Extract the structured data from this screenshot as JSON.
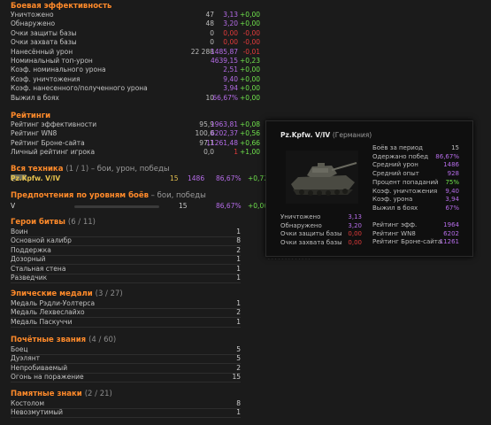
{
  "combat": {
    "title": "Боевая эффективность",
    "rows": [
      {
        "label": "Уничтожено",
        "v1": "47",
        "v2": "3,13",
        "v3": "+0,00",
        "c2": "pur",
        "c3": "grn"
      },
      {
        "label": "Обнаружено",
        "v1": "48",
        "v2": "3,20",
        "v3": "+0,00",
        "c2": "pur",
        "c3": "grn"
      },
      {
        "label": "Очки защиты базы",
        "v1": "0",
        "v2": "0,00",
        "v3": "-0,00",
        "c2": "red",
        "c3": "red"
      },
      {
        "label": "Очки захвата базы",
        "v1": "0",
        "v2": "0,00",
        "v3": "-0,00",
        "c2": "red",
        "c3": "red"
      },
      {
        "label": "Нанесённый урон",
        "v1": "22 288",
        "v2": "1485,87",
        "v3": "-0,01",
        "c2": "pur",
        "c3": "red"
      },
      {
        "label": "Номинальный топ-урон",
        "v1": "",
        "v2": "4639,15",
        "v3": "+0,23",
        "c2": "pur",
        "c3": "grn"
      },
      {
        "label": "Коэф. номинального урона",
        "v1": "",
        "v2": "2,51",
        "v3": "+0,00",
        "c2": "pur",
        "c3": "grn"
      },
      {
        "label": "Коэф. уничтожения",
        "v1": "",
        "v2": "9,40",
        "v3": "+0,00",
        "c2": "pur",
        "c3": "grn"
      },
      {
        "label": "Коэф. нанесенного/полученного урона",
        "v1": "",
        "v2": "3,94",
        "v3": "+0,00",
        "c2": "pur",
        "c3": "grn"
      },
      {
        "label": "Выжил в боях",
        "v1": "10",
        "v2": "66,67%",
        "v3": "+0,00",
        "c2": "pur",
        "c3": "grn"
      }
    ]
  },
  "ratings": {
    "title": "Рейтинги",
    "rows": [
      {
        "label": "Рейтинг эффективности",
        "v1": "95,9",
        "v2": "1963,81",
        "v3": "+0,08",
        "c2": "pur",
        "c3": "grn"
      },
      {
        "label": "Рейтинг WN8",
        "v1": "100,0",
        "v2": "6202,37",
        "v3": "+0,56",
        "c2": "pur",
        "c3": "grn"
      },
      {
        "label": "Рейтинг Броне-сайта",
        "v1": "97,1",
        "v2": "11261,48",
        "v3": "+0,66",
        "c2": "pur",
        "c3": "grn"
      },
      {
        "label": "Личный рейтинг игрока",
        "v1": "0,0",
        "v2": "1",
        "v3": "+1,00",
        "c2": "red",
        "c3": "grn"
      }
    ]
  },
  "vehicles": {
    "title": "Вся техника",
    "count": "(1 / 1)",
    "sub": " – бои, урон, победы",
    "row": {
      "tier": "V",
      "name": "Pz.Kpfw. V/IV",
      "battles": "15",
      "damage": "1486",
      "wins": "86,67%",
      "delta": "+0,72"
    }
  },
  "tiers": {
    "title": "Предпочтения по уровням боёв",
    "sub": " – бои, победы",
    "row": {
      "tier": "V",
      "battles": "15",
      "wins": "86,67%",
      "delta": "+0,06"
    }
  },
  "heroes": {
    "title": "Герои битвы",
    "count": "(6 / 11)",
    "rows": [
      {
        "label": "Воин",
        "count": "1"
      },
      {
        "label": "Основной калибр",
        "count": "8"
      },
      {
        "label": "Поддержка",
        "count": "2"
      },
      {
        "label": "Дозорный",
        "count": "1"
      },
      {
        "label": "Стальная стена",
        "count": "1"
      },
      {
        "label": "Разведчик",
        "count": "1"
      }
    ]
  },
  "epic": {
    "title": "Эпические медали",
    "count": "(3 / 27)",
    "rows": [
      {
        "label": "Медаль Рэдли-Уолтерса",
        "count": "1"
      },
      {
        "label": "Медаль Лехвеслайхо",
        "count": "2"
      },
      {
        "label": "Медаль Паскуччи",
        "count": "1"
      }
    ]
  },
  "titles": {
    "title": "Почётные звания",
    "count": "(4 / 60)",
    "rows": [
      {
        "label": "Боец",
        "count": "5"
      },
      {
        "label": "Дуэлянт",
        "count": "5"
      },
      {
        "label": "Непробиваемый",
        "count": "2"
      },
      {
        "label": "Огонь на поражение",
        "count": "15"
      }
    ]
  },
  "commemorative": {
    "title": "Памятные знаки",
    "count": "(2 / 21)",
    "rows": [
      {
        "label": "Костолом",
        "count": "8"
      },
      {
        "label": "Невозмутимый",
        "count": "1"
      }
    ]
  },
  "tooltip": {
    "title": "Pz.Kpfw. V/IV",
    "nation": "(Германия)",
    "right": [
      {
        "label": "Боёв за период",
        "value": "15",
        "color": "#bdbdbd"
      },
      {
        "label": "Одержано побед",
        "value": "86,67%",
        "color": "#b56ce8"
      },
      {
        "label": "Средний урон",
        "value": "1486",
        "color": "#b56ce8"
      },
      {
        "label": "Средний опыт",
        "value": "928",
        "color": "#b56ce8"
      },
      {
        "label": "Процент попаданий",
        "value": "75%",
        "color": "#6fe24c"
      },
      {
        "label": "Коэф. уничтожения",
        "value": "9,40",
        "color": "#b56ce8"
      },
      {
        "label": "Коэф. урона",
        "value": "3,94",
        "color": "#b56ce8"
      },
      {
        "label": "Выжил в боях",
        "value": "67%",
        "color": "#b56ce8"
      }
    ],
    "left_bottom": [
      {
        "label": "Уничтожено",
        "value": "3,13",
        "color": "#b56ce8"
      },
      {
        "label": "Обнаружено",
        "value": "3,20",
        "color": "#b56ce8"
      },
      {
        "label": "Очки защиты базы",
        "value": "0,00",
        "color": "#e23b3b"
      },
      {
        "label": "Очки захвата базы",
        "value": "0,00",
        "color": "#e23b3b"
      }
    ],
    "right_bottom": [
      {
        "label": "Рейтинг эфф.",
        "value": "1964",
        "color": "#b56ce8"
      },
      {
        "label": "Рейтинг WN8",
        "value": "6202",
        "color": "#b56ce8"
      },
      {
        "label": "Рейтинг Броне-сайта",
        "value": "11261",
        "color": "#b56ce8"
      }
    ]
  }
}
